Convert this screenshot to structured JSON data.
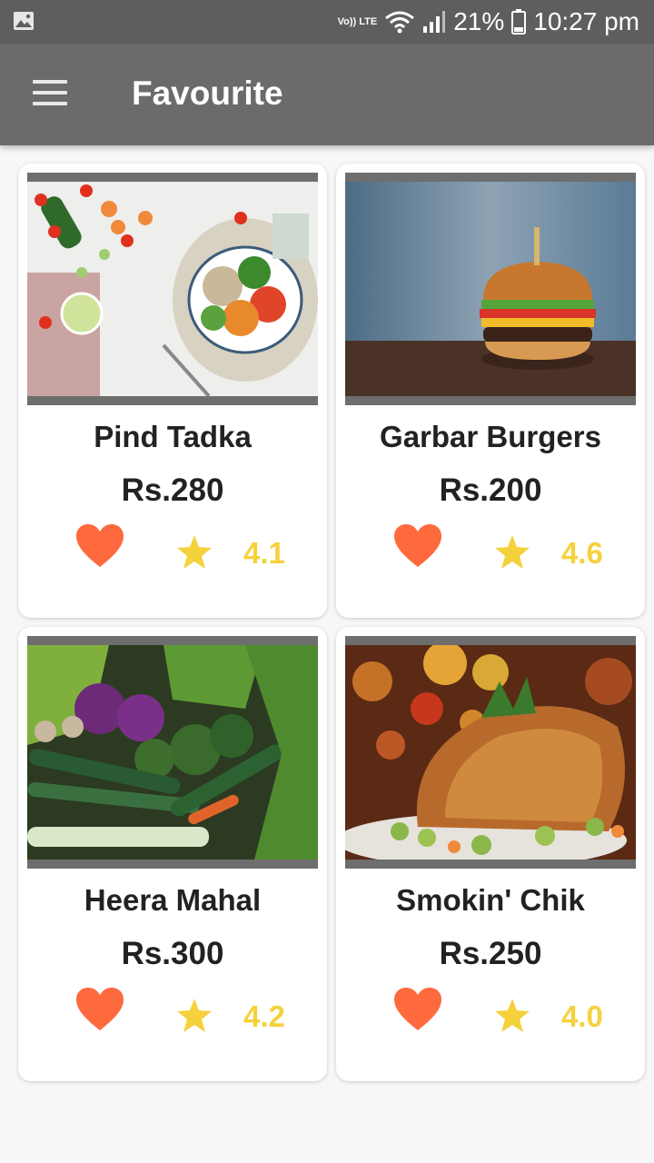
{
  "status_bar": {
    "network": "Vo)) LTE",
    "battery": "21%",
    "time": "10:27 pm"
  },
  "app_bar": {
    "title": "Favourite",
    "menu_icon": "hamburger-menu-icon"
  },
  "colors": {
    "app_bar": "#6b6b6b",
    "status_bar": "#5e5e5e",
    "heart": "#fe6a3e",
    "star": "#f5d13c"
  },
  "items": [
    {
      "name": "Pind Tadka",
      "price": "Rs.280",
      "rating": "4.1",
      "favourite": true,
      "image": "salad-bowl-photo"
    },
    {
      "name": "Garbar Burgers",
      "price": "Rs.200",
      "rating": "4.6",
      "favourite": true,
      "image": "burger-photo"
    },
    {
      "name": "Heera Mahal",
      "price": "Rs.300",
      "rating": "4.2",
      "favourite": true,
      "image": "vegetables-photo"
    },
    {
      "name": "Smokin' Chik",
      "price": "Rs.250",
      "rating": "4.0",
      "favourite": true,
      "image": "roast-chicken-photo"
    }
  ]
}
